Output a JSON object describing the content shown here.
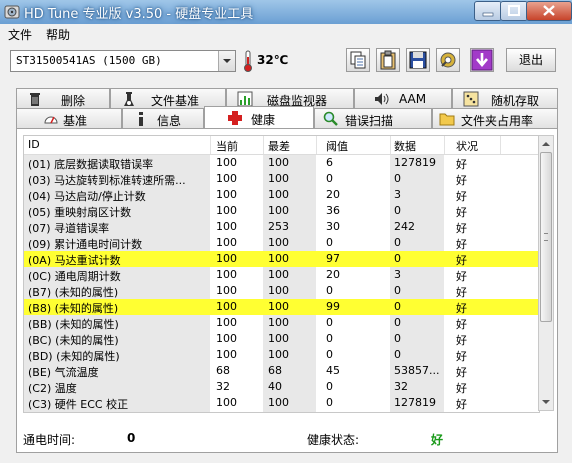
{
  "window": {
    "title": "HD Tune 专业版 v3.50 - 硬盘专业工具"
  },
  "menu": {
    "file": "文件",
    "help": "帮助"
  },
  "toolbar": {
    "drive": "ST31500541AS (1500 GB)",
    "temperature": "32℃",
    "exit_label": "退出"
  },
  "tabs_top": [
    {
      "label": "删除",
      "icon": "trash-icon"
    },
    {
      "label": "文件基准",
      "icon": "info-icon"
    },
    {
      "label": "磁盘监视器",
      "icon": "bar-chart-icon"
    },
    {
      "label": "AAM",
      "icon": "speaker-icon"
    },
    {
      "label": "随机存取",
      "icon": "dice-icon"
    }
  ],
  "tabs_bottom": [
    {
      "label": "基准",
      "icon": "speedometer-icon"
    },
    {
      "label": "信息",
      "icon": "info-icon"
    },
    {
      "label": "健康",
      "icon": "red-cross-icon"
    },
    {
      "label": "错误扫描",
      "icon": "magnifier-icon"
    },
    {
      "label": "文件夹占用率",
      "icon": "folder-icon"
    }
  ],
  "table": {
    "headers": {
      "id": "ID",
      "current": "当前",
      "worst": "最差",
      "threshold": "阈值",
      "data": "数据",
      "status": "状况"
    },
    "rows": [
      {
        "id": "(01) 底层数据读取错误率",
        "current": "100",
        "worst": "100",
        "threshold": "6",
        "data": "127819",
        "status": "好",
        "highlight": false
      },
      {
        "id": "(03) 马达旋转到标准转速所需...",
        "current": "100",
        "worst": "100",
        "threshold": "0",
        "data": "0",
        "status": "好",
        "highlight": false
      },
      {
        "id": "(04) 马达启动/停止计数",
        "current": "100",
        "worst": "100",
        "threshold": "20",
        "data": "3",
        "status": "好",
        "highlight": false
      },
      {
        "id": "(05) 重映射扇区计数",
        "current": "100",
        "worst": "100",
        "threshold": "36",
        "data": "0",
        "status": "好",
        "highlight": false
      },
      {
        "id": "(07) 寻道错误率",
        "current": "100",
        "worst": "253",
        "threshold": "30",
        "data": "242",
        "status": "好",
        "highlight": false
      },
      {
        "id": "(09) 累计通电时间计数",
        "current": "100",
        "worst": "100",
        "threshold": "0",
        "data": "0",
        "status": "好",
        "highlight": false
      },
      {
        "id": "(0A) 马达重试计数",
        "current": "100",
        "worst": "100",
        "threshold": "97",
        "data": "0",
        "status": "好",
        "highlight": true
      },
      {
        "id": "(0C) 通电周期计数",
        "current": "100",
        "worst": "100",
        "threshold": "20",
        "data": "3",
        "status": "好",
        "highlight": false
      },
      {
        "id": "(B7) (未知的属性)",
        "current": "100",
        "worst": "100",
        "threshold": "0",
        "data": "0",
        "status": "好",
        "highlight": false
      },
      {
        "id": "(B8) (未知的属性)",
        "current": "100",
        "worst": "100",
        "threshold": "99",
        "data": "0",
        "status": "好",
        "highlight": true
      },
      {
        "id": "(BB) (未知的属性)",
        "current": "100",
        "worst": "100",
        "threshold": "0",
        "data": "0",
        "status": "好",
        "highlight": false
      },
      {
        "id": "(BC) (未知的属性)",
        "current": "100",
        "worst": "100",
        "threshold": "0",
        "data": "0",
        "status": "好",
        "highlight": false
      },
      {
        "id": "(BD) (未知的属性)",
        "current": "100",
        "worst": "100",
        "threshold": "0",
        "data": "0",
        "status": "好",
        "highlight": false
      },
      {
        "id": "(BE) 气流温度",
        "current": "68",
        "worst": "68",
        "threshold": "45",
        "data": "53857...",
        "status": "好",
        "highlight": false
      },
      {
        "id": "(C2) 温度",
        "current": "32",
        "worst": "40",
        "threshold": "0",
        "data": "32",
        "status": "好",
        "highlight": false
      },
      {
        "id": "(C3) 硬件 ECC 校正",
        "current": "100",
        "worst": "100",
        "threshold": "0",
        "data": "127819",
        "status": "好",
        "highlight": false
      },
      {
        "id": "(C5) 当前待映射的扇区数",
        "current": "100",
        "worst": "100",
        "threshold": "0",
        "data": "0",
        "status": "好",
        "highlight": false
      }
    ]
  },
  "footer": {
    "power_on_label": "通电时间:",
    "power_on_value": "0",
    "health_label": "健康状态:",
    "health_value": "好"
  },
  "colors": {
    "highlight": "#ffff32",
    "health_good": "#1a9a1a",
    "title_bar": "#6b9fd3"
  }
}
